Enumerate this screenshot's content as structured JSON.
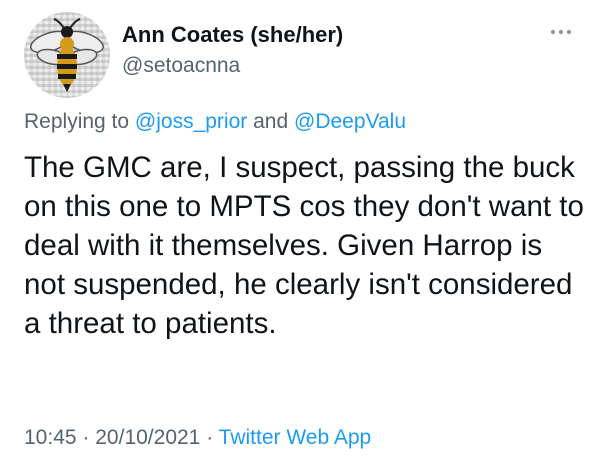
{
  "author": {
    "display_name": "Ann Coates (she/her)",
    "handle": "@setoacnna",
    "avatar_icon": "bee-icon"
  },
  "more_icon": "more-horizontal-icon",
  "reply_context": {
    "prefix": "Replying to",
    "mention_1": "@joss_prior",
    "joiner": "and",
    "mention_2": "@DeepValu"
  },
  "tweet_text": "The GMC are, I suspect, passing the buck on this one to MPTS cos they don't want to deal with it themselves. Given Harrop is not suspended, he clearly isn't considered a threat to patients.",
  "meta": {
    "time": "10:45",
    "separator": "·",
    "date": "20/10/2021",
    "source": "Twitter Web App"
  },
  "colors": {
    "link": "#1d9bf0",
    "secondary_text": "#536471",
    "primary_text": "#0f1419"
  }
}
